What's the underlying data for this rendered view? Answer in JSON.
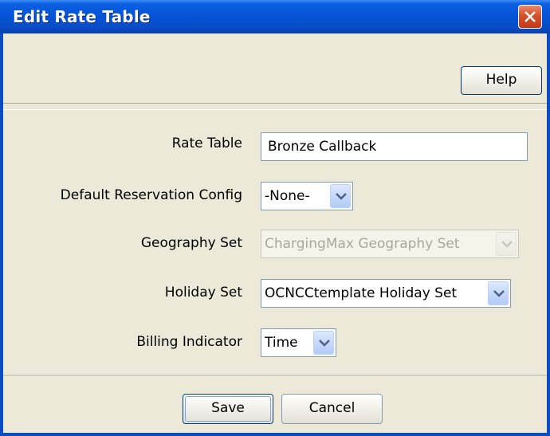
{
  "dialog": {
    "title": "Edit Rate Table"
  },
  "toolbar": {
    "help_label": "Help"
  },
  "form": {
    "rate_table": {
      "label": "Rate Table",
      "value": "Bronze Callback"
    },
    "default_reservation_config": {
      "label": "Default Reservation Config",
      "value": "-None-"
    },
    "geography_set": {
      "label": "Geography Set",
      "value": "ChargingMax Geography Set",
      "disabled": true
    },
    "holiday_set": {
      "label": "Holiday Set",
      "value": "OCNCCtemplate Holiday Set"
    },
    "billing_indicator": {
      "label": "Billing Indicator",
      "value": "Time"
    }
  },
  "footer": {
    "save_label": "Save",
    "cancel_label": "Cancel"
  },
  "colors": {
    "titlebar": "#0553d6",
    "panel": "#ece9d8",
    "close": "#d6502a"
  }
}
